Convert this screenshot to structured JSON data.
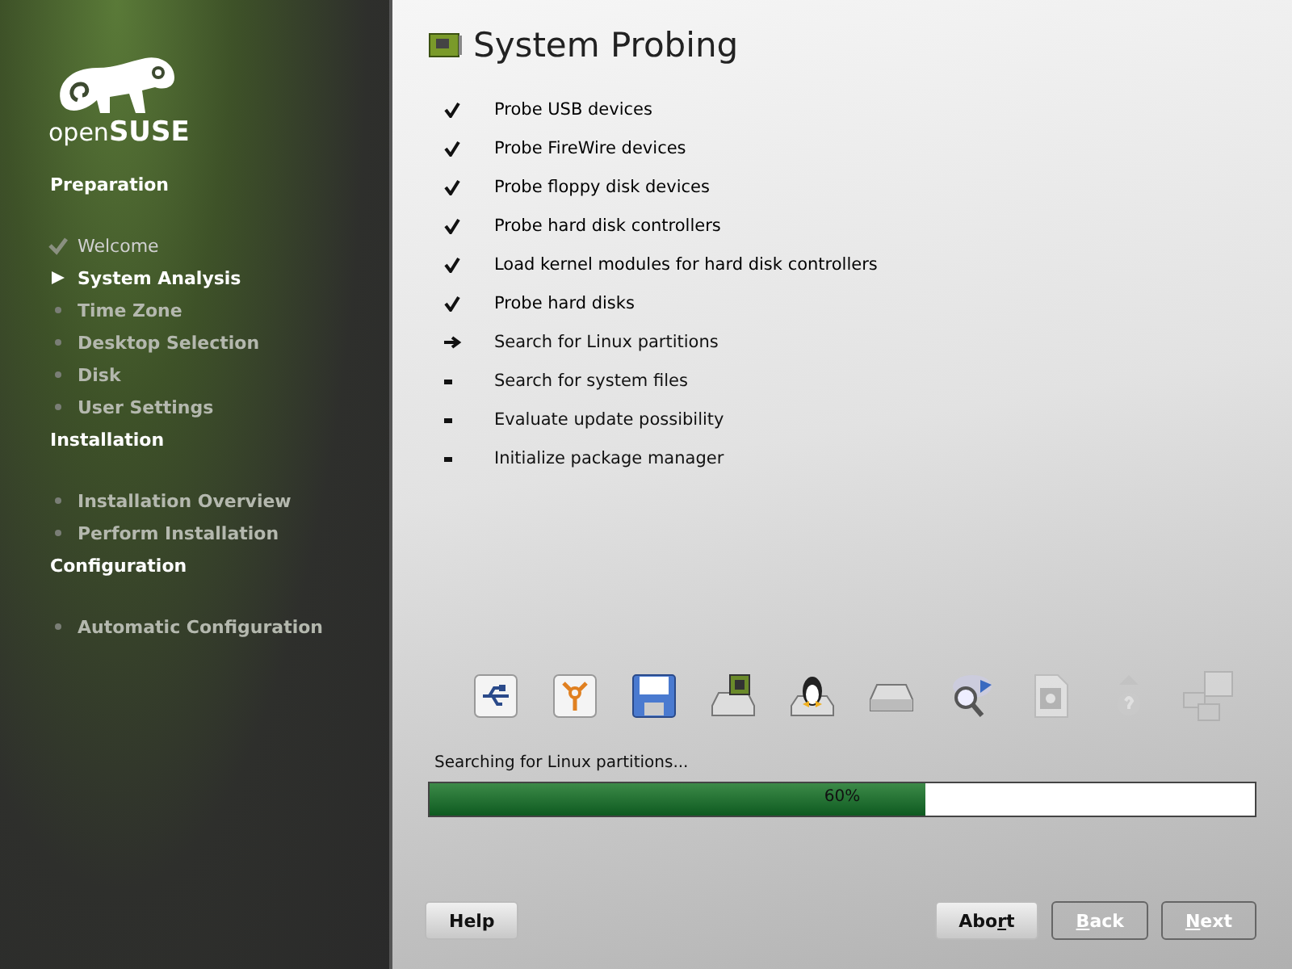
{
  "sidebar": {
    "logo": {
      "prefix": "open",
      "name": "SUSE"
    },
    "sections": [
      {
        "title": "Preparation",
        "items": [
          {
            "label": "Welcome",
            "done": true,
            "current": false
          },
          {
            "label": "System Analysis",
            "done": false,
            "current": true
          },
          {
            "label": "Time Zone",
            "done": false,
            "current": false
          },
          {
            "label": "Desktop Selection",
            "done": false,
            "current": false
          },
          {
            "label": "Disk",
            "done": false,
            "current": false
          },
          {
            "label": "User Settings",
            "done": false,
            "current": false
          }
        ]
      },
      {
        "title": "Installation",
        "items": [
          {
            "label": "Installation Overview",
            "done": false,
            "current": false
          },
          {
            "label": "Perform Installation",
            "done": false,
            "current": false
          }
        ]
      },
      {
        "title": "Configuration",
        "items": [
          {
            "label": "Automatic Configuration",
            "done": false,
            "current": false
          }
        ]
      }
    ]
  },
  "title": "System Probing",
  "steps": [
    {
      "label": "Probe USB devices",
      "done": true,
      "current": false
    },
    {
      "label": "Probe FireWire devices",
      "done": true,
      "current": false
    },
    {
      "label": "Probe floppy disk devices",
      "done": true,
      "current": false
    },
    {
      "label": "Probe hard disk controllers",
      "done": true,
      "current": false
    },
    {
      "label": "Load kernel modules for hard disk controllers",
      "done": true,
      "current": false
    },
    {
      "label": "Probe hard disks",
      "done": true,
      "current": false
    },
    {
      "label": "Search for Linux partitions",
      "done": false,
      "current": true
    },
    {
      "label": "Search for system files",
      "done": false,
      "current": false
    },
    {
      "label": "Evaluate update possibility",
      "done": false,
      "current": false
    },
    {
      "label": "Initialize package manager",
      "done": false,
      "current": false
    }
  ],
  "stage_icons": [
    {
      "kind": "usb",
      "disabled": false
    },
    {
      "kind": "firewire",
      "disabled": false
    },
    {
      "kind": "floppy",
      "disabled": false
    },
    {
      "kind": "controller",
      "disabled": false
    },
    {
      "kind": "penguin",
      "disabled": false
    },
    {
      "kind": "disk",
      "disabled": false
    },
    {
      "kind": "search",
      "disabled": false
    },
    {
      "kind": "file",
      "disabled": true
    },
    {
      "kind": "question",
      "disabled": true
    },
    {
      "kind": "blocks",
      "disabled": true
    }
  ],
  "progress": {
    "message": "Searching for Linux partitions...",
    "level": 0.6,
    "label": "60%"
  },
  "buttons": [
    {
      "text": "Help",
      "disabled": false,
      "kind": "help"
    },
    {
      "text": "Abo",
      "mnemonic": "r",
      "rest": "t",
      "disabled": false,
      "kind": "abort"
    },
    {
      "mnemonic": "B",
      "rest": "ack",
      "disabled": true,
      "kind": "back"
    },
    {
      "mnemonic": "N",
      "rest": "ext",
      "disabled": true,
      "kind": "next"
    }
  ]
}
